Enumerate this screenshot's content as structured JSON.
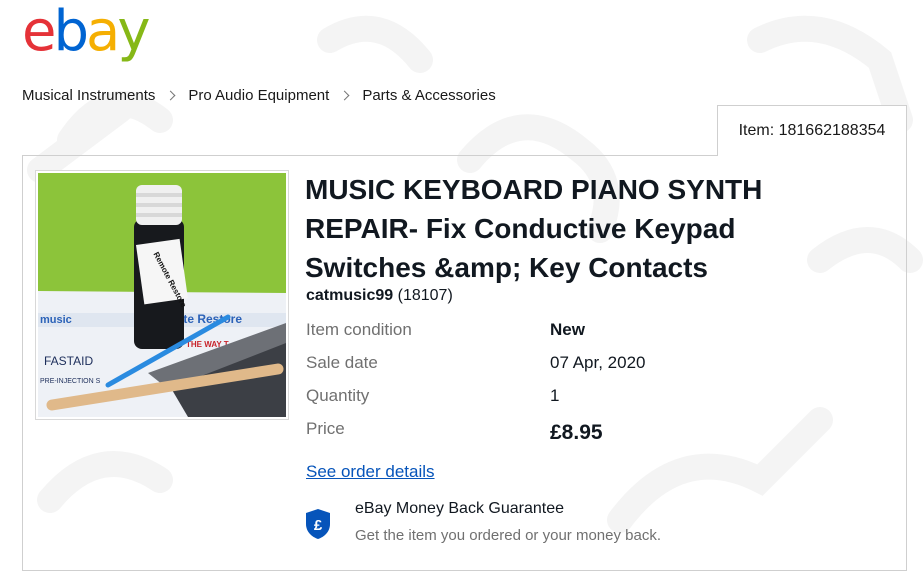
{
  "logo": {
    "letters": [
      "e",
      "b",
      "a",
      "y"
    ],
    "colors": [
      "#e53238",
      "#0064d2",
      "#f5af02",
      "#86b817"
    ]
  },
  "breadcrumb": [
    {
      "label": "Musical Instruments"
    },
    {
      "label": "Pro Audio Equipment"
    },
    {
      "label": "Parts & Accessories"
    }
  ],
  "item": {
    "tab_label": "Item: 181662188354",
    "title_lines": [
      "MUSIC KEYBOARD PIANO SYNTH",
      "REPAIR- Fix Conductive Keypad",
      "Switches &amp; Key Contacts"
    ],
    "seller_name": "catmusic99",
    "seller_feedback": "(18107)",
    "image": {
      "bottle_label": "Remote Restore",
      "paper_texts": [
        "music",
        "Remote Restore",
        "THE WAY T",
        "FASTAID",
        "PRE-INJECTION S"
      ]
    }
  },
  "details": {
    "condition_label": "Item condition",
    "condition_value": "New",
    "date_label": "Sale date",
    "date_value": "07 Apr, 2020",
    "qty_label": "Quantity",
    "qty_value": "1",
    "price_label": "Price",
    "price_value": "£8.95"
  },
  "order_link": "See order details",
  "guarantee": {
    "title": "eBay Money Back Guarantee",
    "subtitle": "Get the item you ordered or your money back.",
    "icon": "pound-shield-icon",
    "icon_glyph": "£",
    "icon_color": "#0654ba"
  },
  "colors": {
    "link": "#0654ba",
    "border": "#cfcfcf",
    "muted_text": "#707070"
  }
}
